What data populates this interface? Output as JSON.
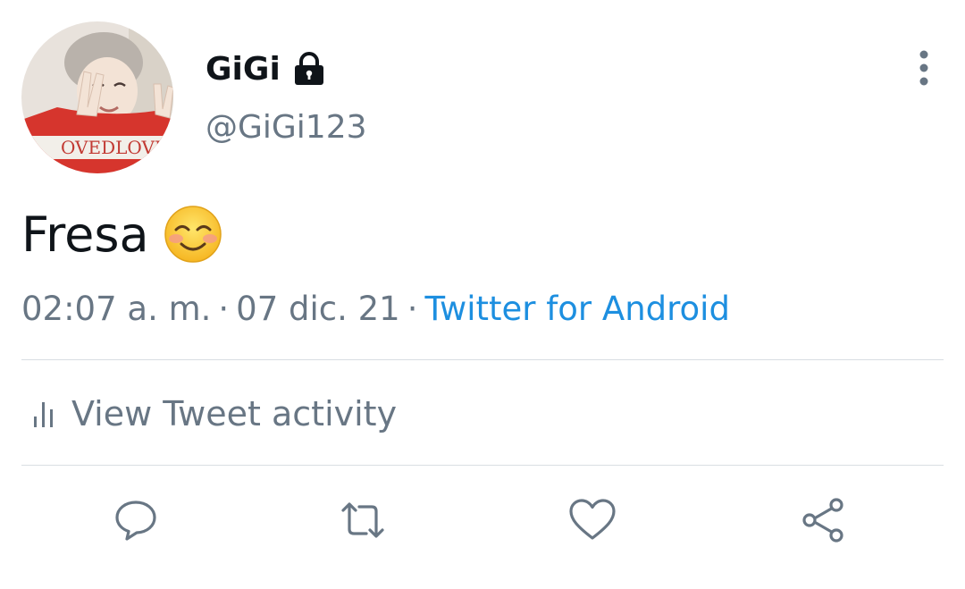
{
  "author": {
    "display_name": "GiGi",
    "username": "@GiGi123",
    "protected_icon": "lock-icon",
    "avatar_icon": "avatar-photo"
  },
  "tweet": {
    "text": "Fresa",
    "emoji": "smiling-face-with-smiling-eyes"
  },
  "meta": {
    "time": "02:07 a. m.",
    "separator": "·",
    "date": "07 dic. 21",
    "source": "Twitter for Android"
  },
  "activity": {
    "label": "View Tweet activity",
    "icon": "bar-chart-icon"
  },
  "actions": {
    "icons": [
      "reply-icon",
      "retweet-icon",
      "like-icon",
      "share-icon"
    ]
  },
  "colors": {
    "text_primary": "#0f1419",
    "text_secondary": "#687684",
    "link": "#1d8fe0",
    "divider": "#d9dee3"
  }
}
